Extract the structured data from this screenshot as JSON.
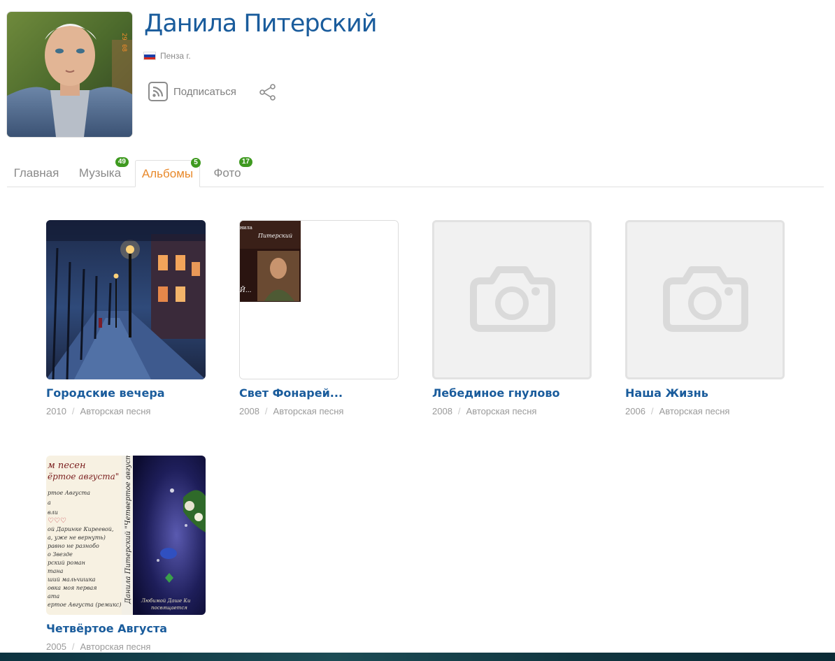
{
  "profile": {
    "name": "Данила Питерский",
    "location": "Пенза г.",
    "flag_colors": [
      "#ffffff",
      "#1c3fa8",
      "#d52b1e"
    ],
    "subscribe_label": "Подписаться",
    "subscribe_icon": "rss-icon",
    "share_icon": "share-icon"
  },
  "tabs": [
    {
      "label": "Главная",
      "badge": ""
    },
    {
      "label": "Музыка",
      "badge": "49"
    },
    {
      "label": "Альбомы",
      "badge": "5",
      "active": true
    },
    {
      "label": "Фото",
      "badge": "17"
    }
  ],
  "albums": [
    {
      "title": "Городские вечера",
      "year": "2010",
      "genre": "Авторская песня",
      "cover": "night-street-painting"
    },
    {
      "title": "Свет Фонарей...",
      "year": "2008",
      "genre": "Авторская песня",
      "cover": "portrait-thumbnail"
    },
    {
      "title": "Лебединое гнулово",
      "year": "2008",
      "genre": "Авторская песня",
      "cover": "camera-placeholder"
    },
    {
      "title": "Наша Жизнь",
      "year": "2006",
      "genre": "Авторская песня",
      "cover": "camera-placeholder"
    },
    {
      "title": "Четвёртое Августа",
      "year": "2005",
      "genre": "Авторская песня",
      "cover": "cassette-cover"
    }
  ],
  "colors": {
    "link_blue": "#1a5c9c",
    "active_tab_orange": "#e8892b",
    "badge_green": "#3f9a20",
    "muted_gray": "#8a8a8a"
  }
}
